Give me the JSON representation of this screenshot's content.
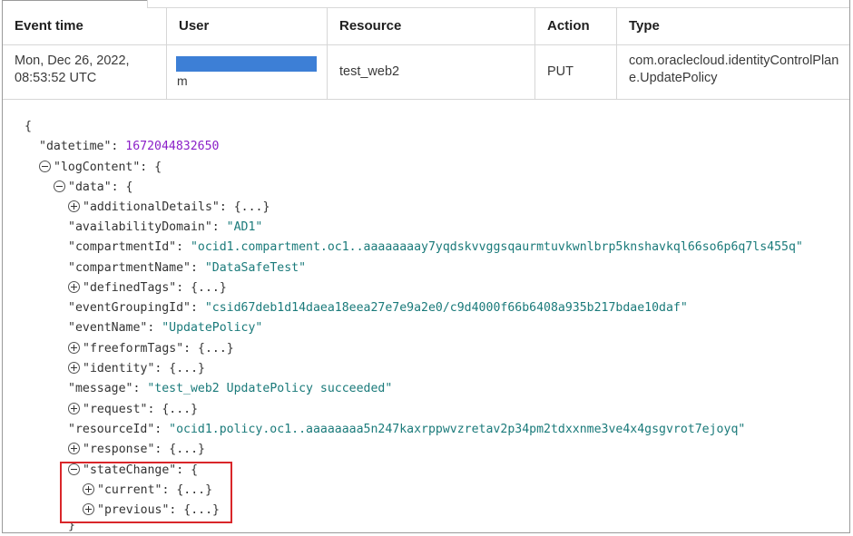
{
  "table": {
    "headers": {
      "event_time": "Event time",
      "user": "User",
      "resource": "Resource",
      "action": "Action",
      "type": "Type"
    },
    "row": {
      "event_time_line1": "Mon, Dec 26, 2022,",
      "event_time_line2": "08:53:52 UTC",
      "user_visible": "m",
      "resource": "test_web2",
      "action": "PUT",
      "type": "com.oraclecloud.identityControlPlane.UpdatePolicy"
    }
  },
  "json": {
    "open_brace": "{",
    "datetime_key": "\"datetime\": ",
    "datetime_value": "1672044832650",
    "logContent_key": "\"logContent\": {",
    "data_key": "\"data\": {",
    "additionalDetails": "\"additionalDetails\": {...}",
    "availabilityDomain_key": "\"availabilityDomain\": ",
    "availabilityDomain_value": "\"AD1\"",
    "compartmentId_key": "\"compartmentId\": ",
    "compartmentId_value": "\"ocid1.compartment.oc1..aaaaaaaay7yqdskvvggsqaurmtuvkwnlbrp5knshavkql66so6p6q7ls455q\"",
    "compartmentName_key": "\"compartmentName\": ",
    "compartmentName_value": "\"DataSafeTest\"",
    "definedTags": "\"definedTags\": {...}",
    "eventGroupingId_key": "\"eventGroupingId\": ",
    "eventGroupingId_value": "\"csid67deb1d14daea18eea27e7e9a2e0/c9d4000f66b6408a935b217bdae10daf\"",
    "eventName_key": "\"eventName\": ",
    "eventName_value": "\"UpdatePolicy\"",
    "freeformTags": "\"freeformTags\": {...}",
    "identity": "\"identity\": {...}",
    "message_key": "\"message\": ",
    "message_value": "\"test_web2 UpdatePolicy succeeded\"",
    "request": "\"request\": {...}",
    "resourceId_key": "\"resourceId\": ",
    "resourceId_value": "\"ocid1.policy.oc1..aaaaaaaa5n247kaxrppwvzretav2p34pm2tdxxnme3ve4x4gsgvrot7ejoyq\"",
    "response": "\"response\": {...}",
    "stateChange_key": "\"stateChange\": {",
    "current": "\"current\": {...}",
    "previous": "\"previous\": {...}",
    "close_brace": "}"
  },
  "colors": {
    "highlight_box": "#d9262a",
    "string_value": "#1a7a7a",
    "number_value": "#8b20c8",
    "redaction": "#3d7fd6"
  }
}
